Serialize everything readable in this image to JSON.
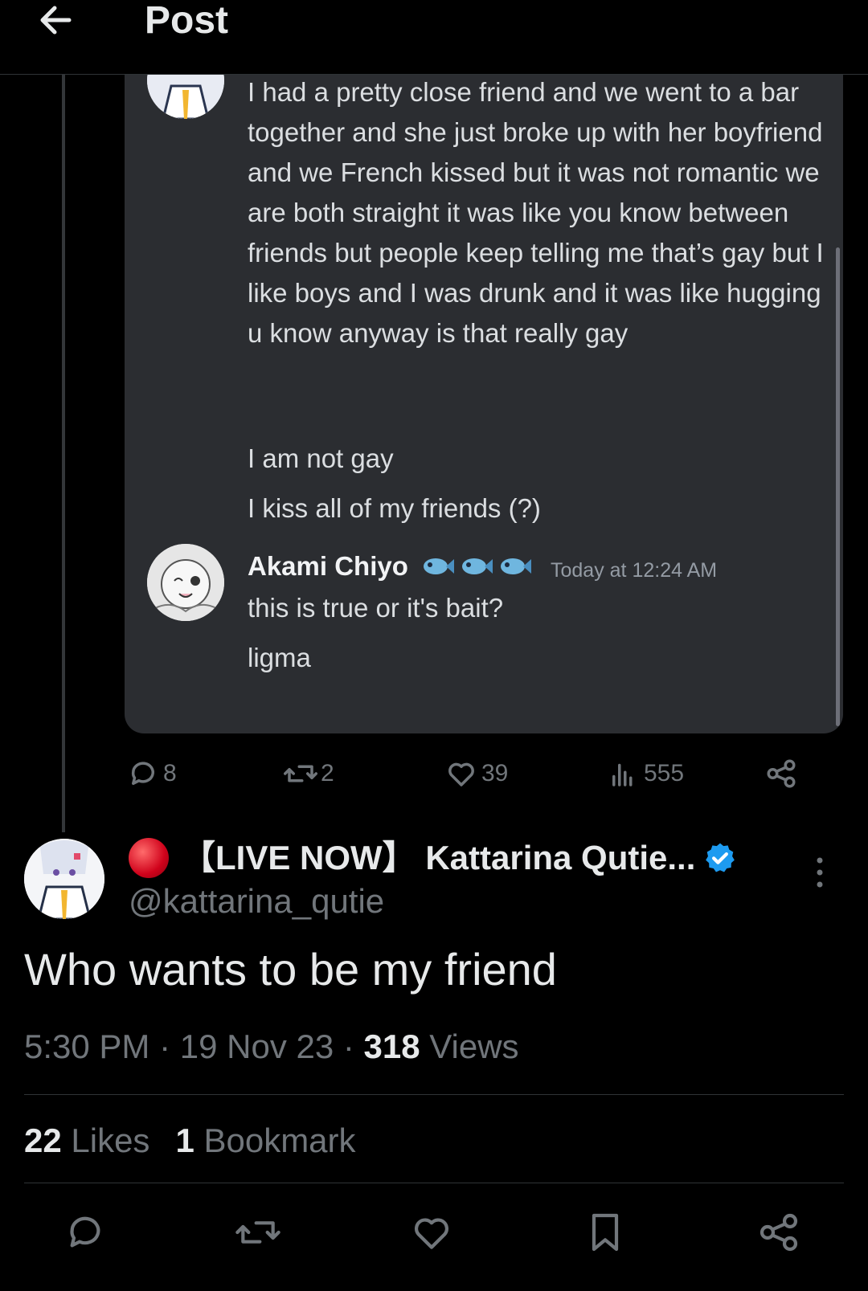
{
  "header": {
    "title": "Post"
  },
  "embed": {
    "message_lines": [
      "I had a pretty close friend and we went to a bar together and she just broke up with her boyfriend and we French kissed but it was not romantic we are both straight it was like you know between friends but people keep telling me that’s gay but I like boys and I was drunk and it was like hugging u know anyway is that really gay",
      "I am not gay",
      "I kiss all of my friends (?)"
    ],
    "reply": {
      "username": "Akami Chiyo",
      "timestamp": "Today at 12:24 AM",
      "lines": [
        "this is true or it's bait?",
        "ligma"
      ]
    }
  },
  "parent_actions": {
    "replies": "8",
    "reposts": "2",
    "likes": "39",
    "views": "555"
  },
  "author": {
    "display_name": "【LIVE NOW】 Kattarina Qutie...",
    "handle": "@kattarina_qutie"
  },
  "tweet": {
    "text": "Who wants to be my friend",
    "time": "5:30 PM · 19 Nov 23 · ",
    "views_count": "318",
    "views_label": " Views"
  },
  "stats": {
    "likes_count": "22",
    "likes_label": " Likes",
    "bookmarks_count": "1",
    "bookmarks_label": " Bookmark"
  },
  "colors": {
    "background": "#000000",
    "card": "#2b2d31",
    "muted": "#71767b",
    "verified": "#1d9bf0"
  }
}
